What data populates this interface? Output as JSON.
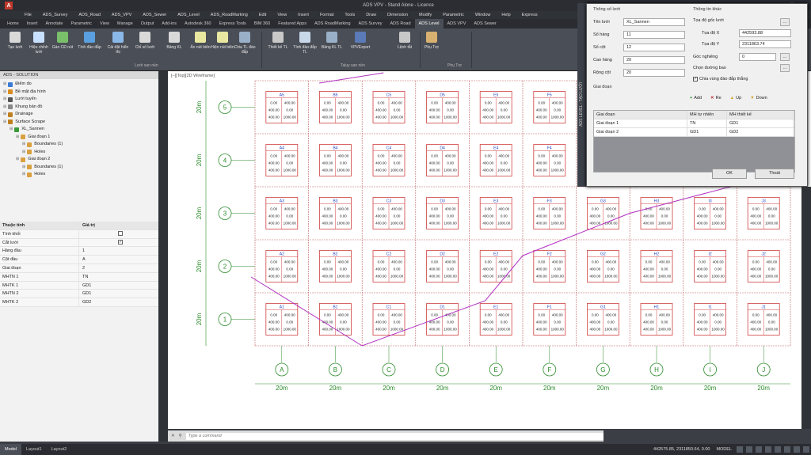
{
  "app": {
    "title": "ADS VPV - Stand Alone - Licence",
    "logo_letter": "A"
  },
  "menu": [
    "File",
    "ADS_Survey",
    "ADS_Road",
    "ADS_VPV",
    "ADS_Sewer",
    "ADS_Level",
    "ADS_RoadMarking",
    "Edit",
    "View",
    "Insert",
    "Format",
    "Tools",
    "Draw",
    "Dimension",
    "Modify",
    "Parametric",
    "Window",
    "Help",
    "Express"
  ],
  "tabs": [
    "Home",
    "Insert",
    "Annotate",
    "Parametric",
    "View",
    "Manage",
    "Output",
    "Add-ins",
    "Autodesk 360",
    "Express Tools",
    "BIM 360",
    "Featured Apps",
    "ADS RoadMarking",
    "ADS Survey",
    "ADS Road",
    "ADS Level",
    "ADS VPV",
    "ADS Sewer"
  ],
  "active_tab": "ADS Level",
  "ribbon": {
    "buttons": [
      "Tạo lưới",
      "Hiệu chỉnh lưới",
      "Gán CĐ nút",
      "Tính đào đắp",
      "Cài đặt hiển thị",
      "Chỉ số lưới",
      "Bảng KL",
      "Ẩn nút biên",
      "Hiện nút biên",
      "Chia TL đào đắp",
      "Thiết kế TL",
      "Tính đào đắp TL",
      "Bảng KL TL",
      "VPVExport",
      "Lệnh tắt",
      "Phụ Trợ"
    ],
    "groups": [
      "Lưới san nền",
      "Taluy san nền",
      "Phụ Trợ"
    ]
  },
  "panel": {
    "title": "ADS - SOLUTION",
    "tree": [
      {
        "label": "Điểm đo",
        "indent": 0,
        "color": "#3a7bd5"
      },
      {
        "label": "Bề mặt địa hình",
        "indent": 0,
        "color": "#d98c1f"
      },
      {
        "label": "Lưới tuyến",
        "indent": 0,
        "color": "#555555"
      },
      {
        "label": "Khung bản đồ",
        "indent": 0,
        "color": "#888888"
      },
      {
        "label": "Drainage",
        "indent": 0,
        "color": "#c08020"
      },
      {
        "label": "Surface Scrape",
        "indent": 0,
        "color": "#c08020"
      },
      {
        "label": "XL_Sannen",
        "indent": 1,
        "color": "#3a9a3a"
      },
      {
        "label": "Giai đoạn 1",
        "indent": 2,
        "color": "#d9a040"
      },
      {
        "label": "Boundaries (1)",
        "indent": 3,
        "color": "#d9a040"
      },
      {
        "label": "Holes",
        "indent": 3,
        "color": "#d9a040"
      },
      {
        "label": "Giai đoạn 2",
        "indent": 2,
        "color": "#d9a040"
      },
      {
        "label": "Boundaries (1)",
        "indent": 3,
        "color": "#d9a040"
      },
      {
        "label": "Holes",
        "indent": 3,
        "color": "#d9a040"
      }
    ],
    "props_header": {
      "k": "Thuộc tính",
      "v": "Giá trị"
    },
    "props": [
      {
        "k": "Tính khối",
        "v": "",
        "check": "unchecked"
      },
      {
        "k": "Cắt lưới",
        "v": "",
        "check": "checked"
      },
      {
        "k": "Hàng đầu",
        "v": "1"
      },
      {
        "k": "Cột đầu",
        "v": "A"
      },
      {
        "k": "Giai đoạn",
        "v": "2"
      },
      {
        "k": "MHTN 1",
        "v": "TN"
      },
      {
        "k": "MHTK 1",
        "v": "GD1"
      },
      {
        "k": "MHTN 2",
        "v": "GD1"
      },
      {
        "k": "MHTK 2",
        "v": "GD2"
      }
    ]
  },
  "viewport": {
    "label": "[–][Top][2D Wireframe]",
    "rows": [
      "1",
      "2",
      "3",
      "4",
      "5"
    ],
    "cols": [
      "A",
      "B",
      "C",
      "D",
      "E",
      "F",
      "G",
      "H",
      "I",
      "J"
    ],
    "spacing_label": "20m",
    "cell_values": [
      "0.00",
      "400.00",
      "400.00",
      "0.00",
      "400.00",
      "1000.00"
    ]
  },
  "cmd": {
    "placeholder": "Type a command"
  },
  "status": {
    "layouts": [
      "Model",
      "Layout1",
      "Layout2"
    ],
    "coords": "442575.85, 2311850.64, 0.00",
    "mode": "MODEL"
  },
  "dialog": {
    "sidebar": "ADS LEVEL - TẠO LƯỚI",
    "section_grid": "Thông số lưới",
    "section_other": "Thông tin khác",
    "fields": [
      {
        "label": "Tên lưới",
        "value": "XL_Sannen"
      },
      {
        "label": "Số hàng",
        "value": "11"
      },
      {
        "label": "Số cột",
        "value": "12"
      },
      {
        "label": "Cao hàng",
        "value": "20"
      },
      {
        "label": "Rộng cột",
        "value": "20"
      }
    ],
    "origin_label": "Tọa độ gốc lưới",
    "x_label": "Tọa độ X",
    "x_value": "442593.88",
    "y_label": "Tọa độ Y",
    "y_value": "2311863.74",
    "angle_label": "Góc nghiêng",
    "angle_value": "0",
    "boundary_label": "Chọn đường bao",
    "checkbox_label": "Chia vùng đào đắp thẳng",
    "stage_section": "Giai đoạn",
    "toolbar": [
      "Add",
      "Re",
      "Up",
      "Down"
    ],
    "table_header": [
      "Giai đoạn",
      "MH tự nhiên",
      "MH thiết kế"
    ],
    "table_rows": [
      [
        "Giai đoạn 1",
        "TN",
        "GD1"
      ],
      [
        "Giai đoạn 2",
        "GD1",
        "GD2"
      ]
    ],
    "ok": "OK",
    "cancel": "Thoát",
    "dots": "..."
  }
}
